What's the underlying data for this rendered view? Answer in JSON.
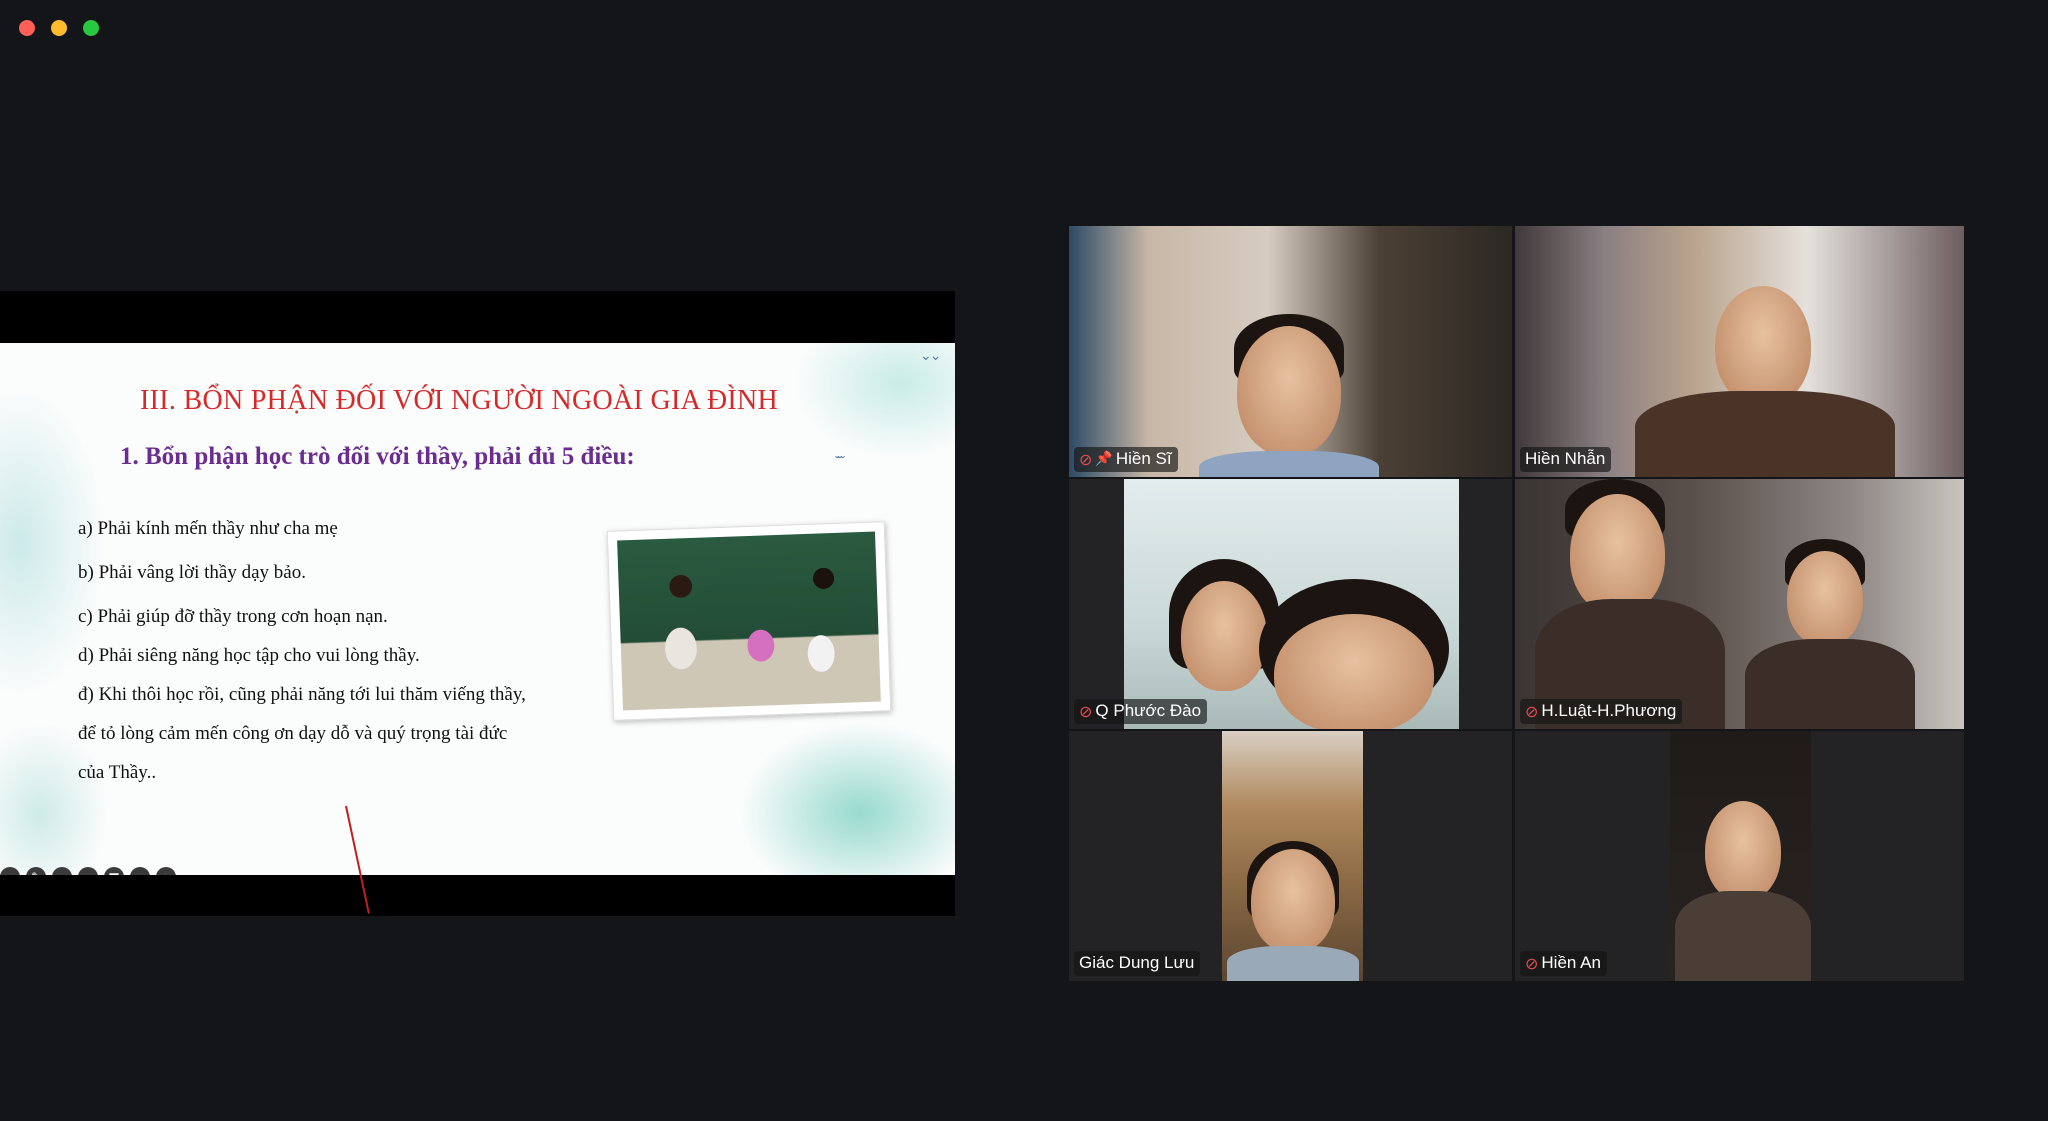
{
  "window": {
    "controls": [
      "close",
      "minimize",
      "maximize"
    ]
  },
  "slide": {
    "title": "III. BỔN PHẬN ĐỐI VỚI NGƯỜI NGOÀI GIA ĐÌNH",
    "subtitle": "1. Bổn phận học trò đối với thầy, phải đủ 5 điều:",
    "items": [
      "a)  Phải kính mến thầy như cha mẹ",
      "b) Phải vâng lời thầy dạy bảo.",
      "c) Phải giúp đỡ thầy trong cơn hoạn nạn.",
      "d) Phải siêng năng học tập cho vui lòng thầy.",
      "đ) Khi thôi học rồi, cũng phải năng tới lui thăm viếng thầy,",
      "để tỏ lòng cảm mến công ơn dạy dỗ và quý trọng tài đức",
      "của Thầy.."
    ],
    "toolbar_icons": [
      "arrow-left-icon",
      "pen-icon",
      "zoom-icon",
      "captions-icon",
      "video-icon",
      "more-icon",
      "arrow-right-icon"
    ]
  },
  "participants": [
    {
      "name": "Hiền Sĩ",
      "muted": true,
      "pinned": true,
      "active": false
    },
    {
      "name": "Hiền Nhẫn",
      "muted": false,
      "pinned": false,
      "active": true
    },
    {
      "name": "Q Phước Đào",
      "muted": true,
      "pinned": false,
      "active": false
    },
    {
      "name": "H.Luật-H.Phương",
      "muted": true,
      "pinned": false,
      "active": false
    },
    {
      "name": "Giác Dung Lưu",
      "muted": false,
      "pinned": false,
      "active": false
    },
    {
      "name": "Hiền An",
      "muted": true,
      "pinned": false,
      "active": false
    }
  ]
}
